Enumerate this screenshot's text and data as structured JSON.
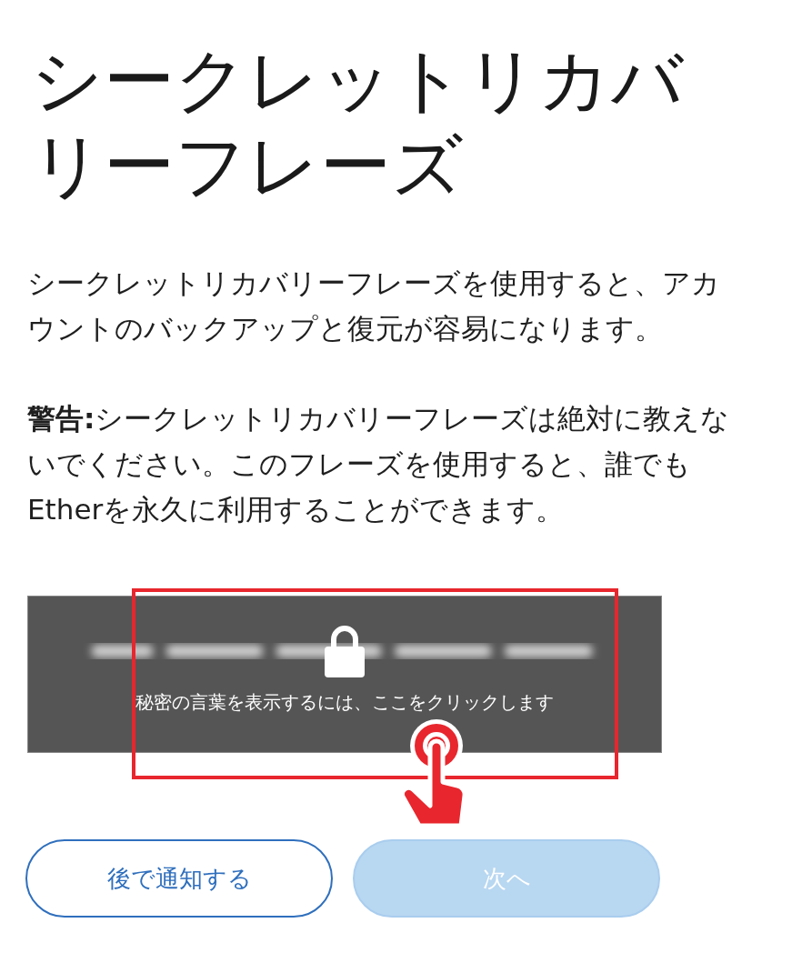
{
  "title": "シークレットリカバリーフレーズ",
  "paragraphs": [
    "シークレットリカバリーフレーズを使用すると、アカウントのバックアップと復元が容易になります。",
    "**警告:**シークレットリカバリーフレーズは絶対に教えないでください。このフレーズを使用すると、誰でもEtherを永久に利用することができます。"
  ],
  "reveal": {
    "label": "秘密の言葉を表示するには、ここをクリックします"
  },
  "buttons": [
    {
      "label": "後で通知する",
      "kind": "outline",
      "disabled": false
    },
    {
      "label": "次へ",
      "kind": "primary",
      "disabled": true
    }
  ]
}
